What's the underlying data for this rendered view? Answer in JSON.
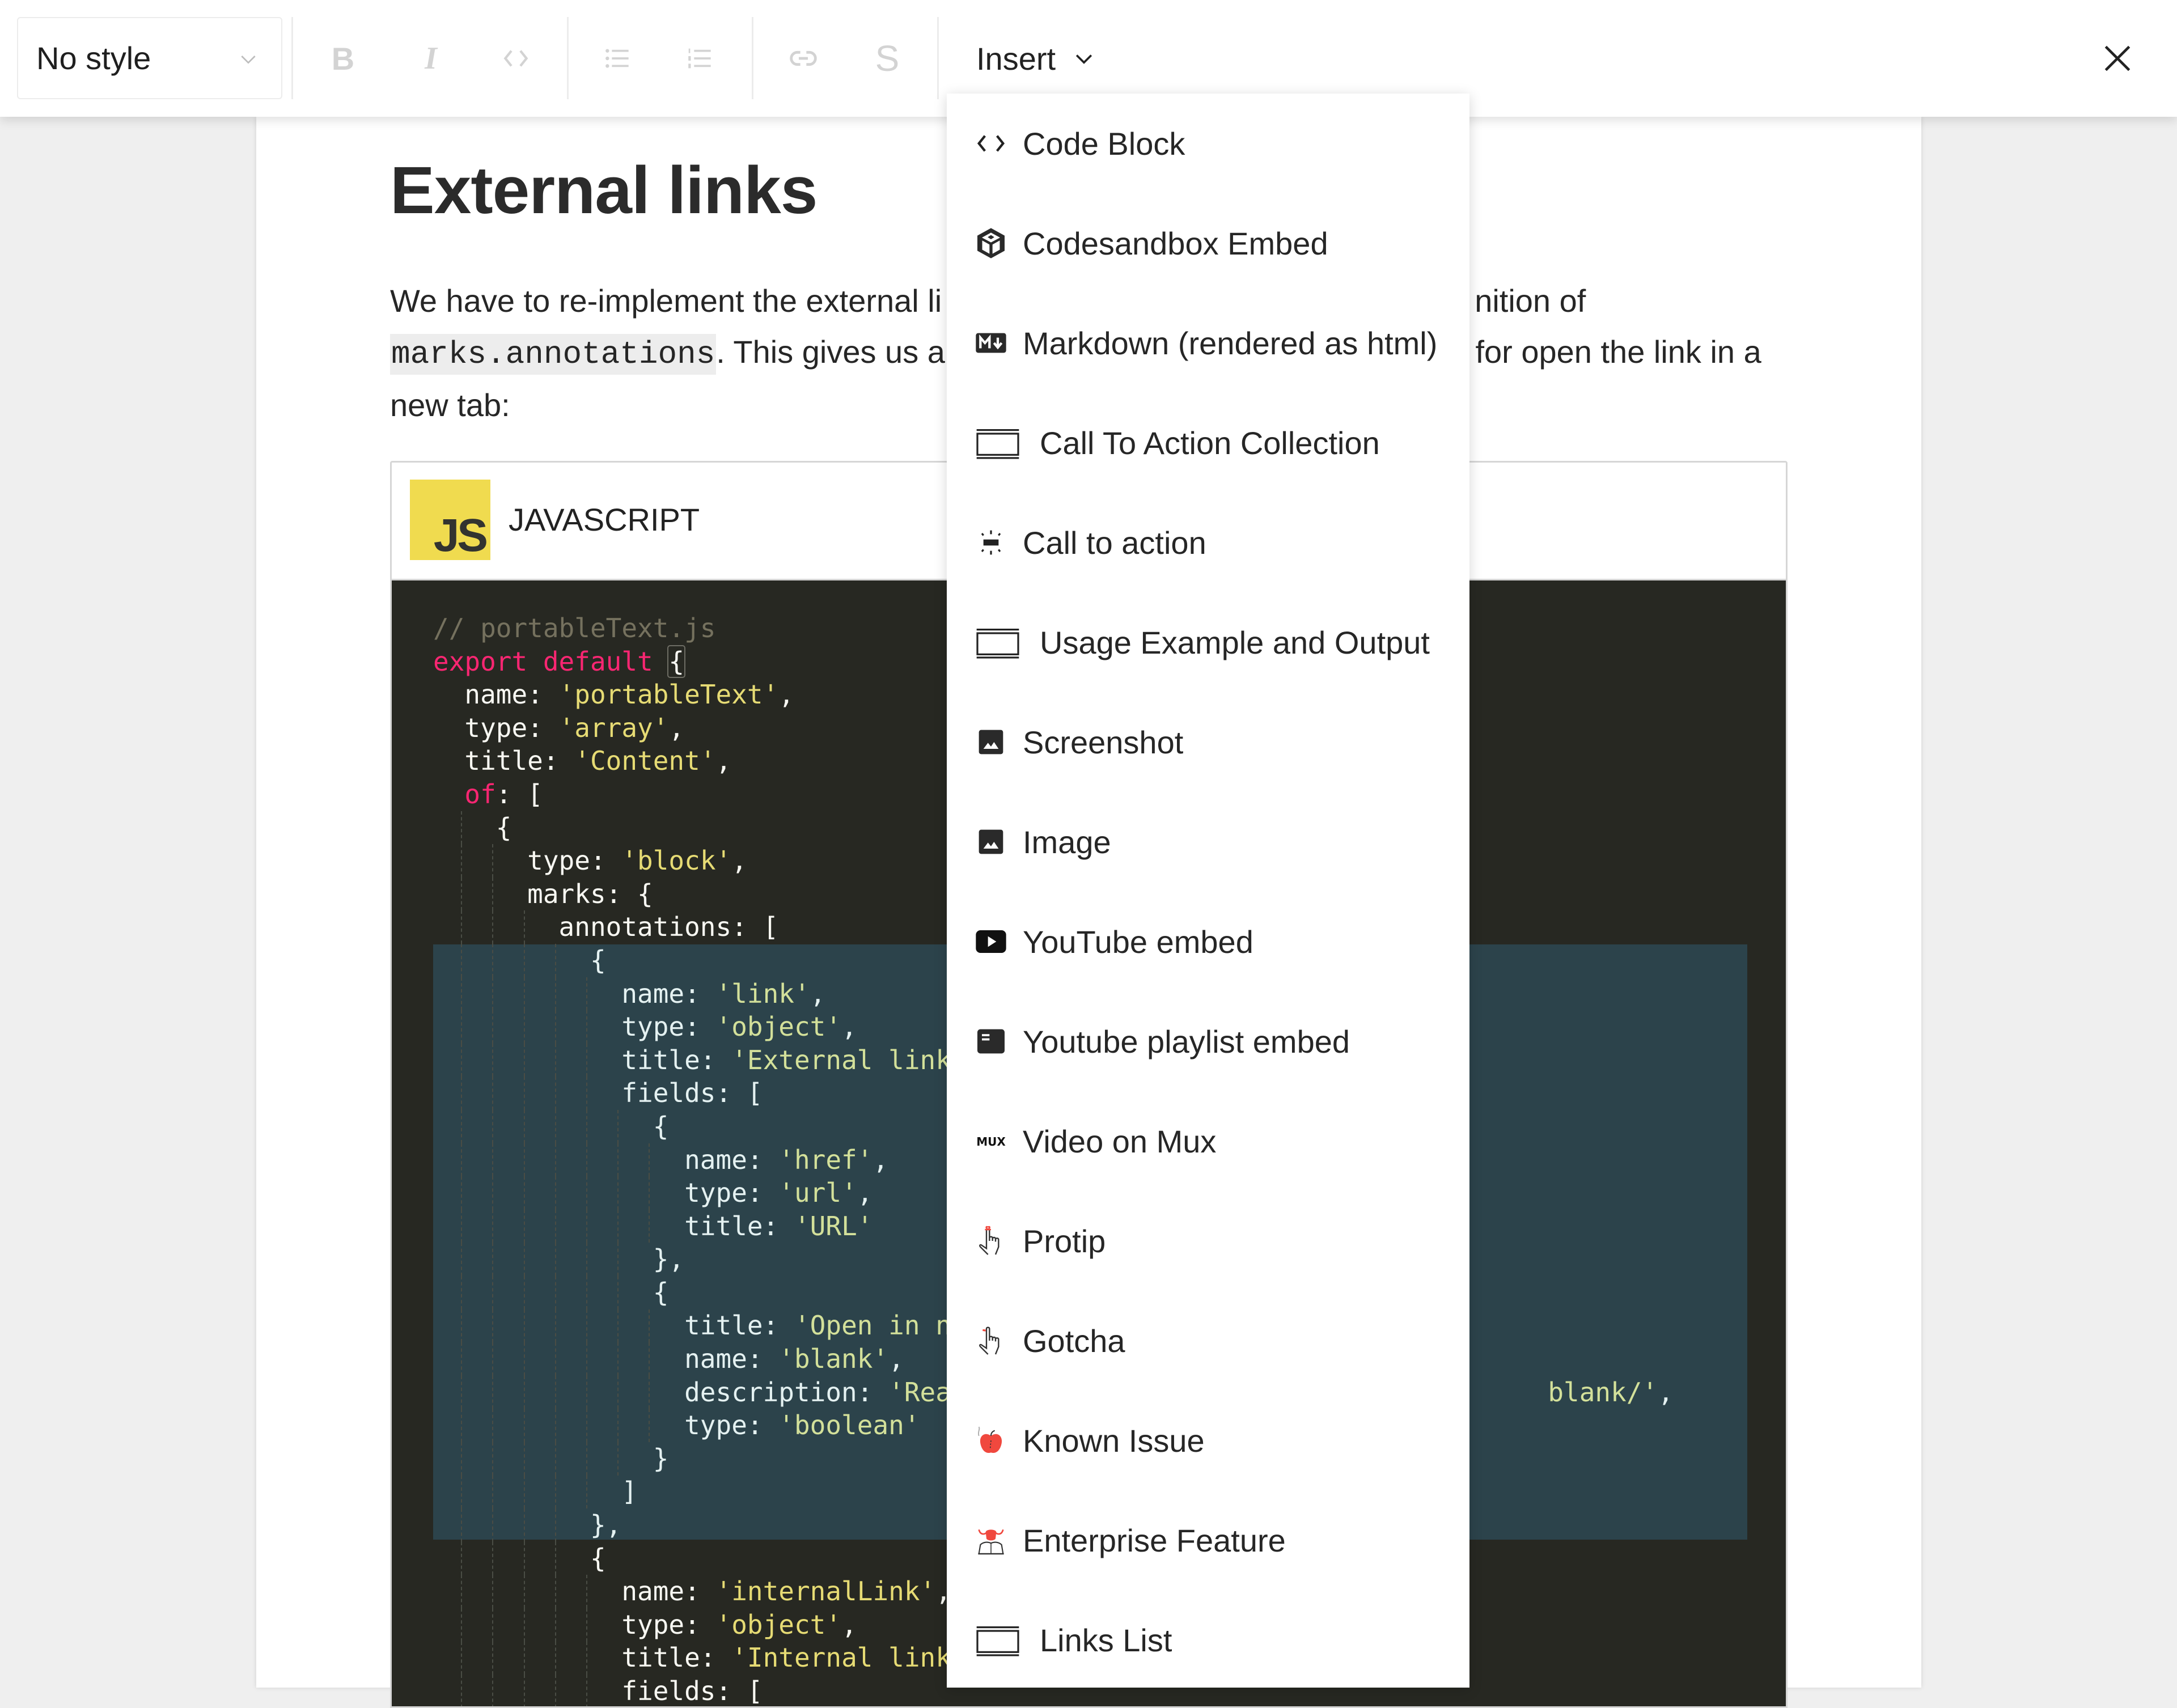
{
  "toolbar": {
    "style_select": {
      "value": "No style"
    },
    "buttons": {
      "bold": "B",
      "italic": "I",
      "code": "code-icon",
      "bullet_list": "bullet-list-icon",
      "numbered_list": "numbered-list-icon",
      "link": "link-icon",
      "strikethrough": "S"
    },
    "insert_label": "Insert",
    "close": "close-icon"
  },
  "document": {
    "title": "External links",
    "paragraph": {
      "line1_start": "We have to re-implement the external li",
      "line1_end": "nition of",
      "inline_code": "marks.annotations",
      "line2_mid": ". This gives us a",
      "line2_end": " for open the link in a",
      "line3": "new tab:"
    },
    "code_block": {
      "language": "JAVASCRIPT",
      "logo_text": "JS",
      "lines": [
        [
          {
            "t": "// portableText.js",
            "c": "comment"
          }
        ],
        [
          {
            "t": "export default ",
            "c": "keyword"
          },
          {
            "t": "{",
            "c": "box"
          }
        ],
        [
          {
            "t": "  name: ",
            "c": "plain"
          },
          {
            "t": "'portableText'",
            "c": "string"
          },
          {
            "t": ",",
            "c": "plain"
          }
        ],
        [
          {
            "t": "  type: ",
            "c": "plain"
          },
          {
            "t": "'array'",
            "c": "string"
          },
          {
            "t": ",",
            "c": "plain"
          }
        ],
        [
          {
            "t": "  title: ",
            "c": "plain"
          },
          {
            "t": "'Content'",
            "c": "string"
          },
          {
            "t": ",",
            "c": "plain"
          }
        ],
        [
          {
            "t": "  ",
            "c": "plain"
          },
          {
            "t": "of",
            "c": "keyword"
          },
          {
            "t": ": [",
            "c": "plain"
          }
        ],
        [
          {
            "t": "    {",
            "c": "plain"
          }
        ],
        [
          {
            "t": "      type: ",
            "c": "plain"
          },
          {
            "t": "'block'",
            "c": "string"
          },
          {
            "t": ",",
            "c": "plain"
          }
        ],
        [
          {
            "t": "      marks: {",
            "c": "plain"
          }
        ],
        [
          {
            "t": "        annotations: [",
            "c": "plain"
          }
        ],
        [
          {
            "t": "          {",
            "c": "plain"
          }
        ],
        [
          {
            "t": "            name: ",
            "c": "plain"
          },
          {
            "t": "'link'",
            "c": "string"
          },
          {
            "t": ",",
            "c": "plain"
          }
        ],
        [
          {
            "t": "            type: ",
            "c": "plain"
          },
          {
            "t": "'object'",
            "c": "string"
          },
          {
            "t": ",",
            "c": "plain"
          }
        ],
        [
          {
            "t": "            title: ",
            "c": "plain"
          },
          {
            "t": "'External link'",
            "c": "string"
          }
        ],
        [
          {
            "t": "            fields: [",
            "c": "plain"
          }
        ],
        [
          {
            "t": "              {",
            "c": "plain"
          }
        ],
        [
          {
            "t": "                name: ",
            "c": "plain"
          },
          {
            "t": "'href'",
            "c": "string"
          },
          {
            "t": ",",
            "c": "plain"
          }
        ],
        [
          {
            "t": "                type: ",
            "c": "plain"
          },
          {
            "t": "'url'",
            "c": "string"
          },
          {
            "t": ",",
            "c": "plain"
          }
        ],
        [
          {
            "t": "                title: ",
            "c": "plain"
          },
          {
            "t": "'URL'",
            "c": "string"
          }
        ],
        [
          {
            "t": "              },",
            "c": "plain"
          }
        ],
        [
          {
            "t": "              {",
            "c": "plain"
          }
        ],
        [
          {
            "t": "                title: ",
            "c": "plain"
          },
          {
            "t": "'Open in new",
            "c": "string"
          }
        ],
        [
          {
            "t": "                name: ",
            "c": "plain"
          },
          {
            "t": "'blank'",
            "c": "string"
          },
          {
            "t": ",",
            "c": "plain"
          }
        ],
        [
          {
            "t": "                description: ",
            "c": "plain"
          },
          {
            "t": "'Read",
            "c": "string"
          },
          {
            "t": "                                     ",
            "c": "plain"
          },
          {
            "t": "blank/'",
            "c": "string"
          },
          {
            "t": ",",
            "c": "plain"
          }
        ],
        [
          {
            "t": "                type: ",
            "c": "plain"
          },
          {
            "t": "'boolean'",
            "c": "string"
          }
        ],
        [
          {
            "t": "              }",
            "c": "plain"
          }
        ],
        [
          {
            "t": "            ]",
            "c": "plain"
          }
        ],
        [
          {
            "t": "          },",
            "c": "plain"
          }
        ],
        [
          {
            "t": "          {",
            "c": "plain"
          }
        ],
        [
          {
            "t": "            name: ",
            "c": "plain"
          },
          {
            "t": "'internalLink'",
            "c": "string"
          },
          {
            "t": ",",
            "c": "plain"
          }
        ],
        [
          {
            "t": "            type: ",
            "c": "plain"
          },
          {
            "t": "'object'",
            "c": "string"
          },
          {
            "t": ",",
            "c": "plain"
          }
        ],
        [
          {
            "t": "            title: ",
            "c": "plain"
          },
          {
            "t": "'Internal link'",
            "c": "string"
          }
        ],
        [
          {
            "t": "            fields: [",
            "c": "plain"
          }
        ]
      ],
      "highlighted_lines": [
        10,
        27
      ]
    }
  },
  "insert_menu": {
    "items": [
      {
        "label": "Code Block",
        "icon": "code-icon"
      },
      {
        "label": "Codesandbox Embed",
        "icon": "codesandbox-icon"
      },
      {
        "label": "Markdown (rendered as html)",
        "icon": "markdown-icon"
      },
      {
        "label": "Call To Action Collection",
        "icon": "window-icon"
      },
      {
        "label": "Call to action",
        "icon": "call-to-action-icon"
      },
      {
        "label": "Usage Example and Output",
        "icon": "window-icon"
      },
      {
        "label": "Screenshot",
        "icon": "image-icon"
      },
      {
        "label": "Image",
        "icon": "image-icon"
      },
      {
        "label": "YouTube embed",
        "icon": "youtube-icon"
      },
      {
        "label": "Youtube playlist embed",
        "icon": "playlist-icon"
      },
      {
        "label": "Video on Mux",
        "icon": "mux-icon"
      },
      {
        "label": "Protip",
        "icon": "protip-hand-icon"
      },
      {
        "label": "Gotcha",
        "icon": "gotcha-hand-icon"
      },
      {
        "label": "Known Issue",
        "icon": "apple-icon"
      },
      {
        "label": "Enterprise Feature",
        "icon": "enterprise-icon"
      },
      {
        "label": "Links List",
        "icon": "window-icon"
      }
    ]
  },
  "colors": {
    "code_bg": "#272822",
    "code_highlight_bg": "#2c434b",
    "keyword": "#f92672",
    "string": "#e6db74",
    "comment": "#75715e",
    "js_logo": "#f0db4f",
    "toolbar_icon_disabled": "#d3d3d3",
    "danger_red": "#f0483e"
  }
}
